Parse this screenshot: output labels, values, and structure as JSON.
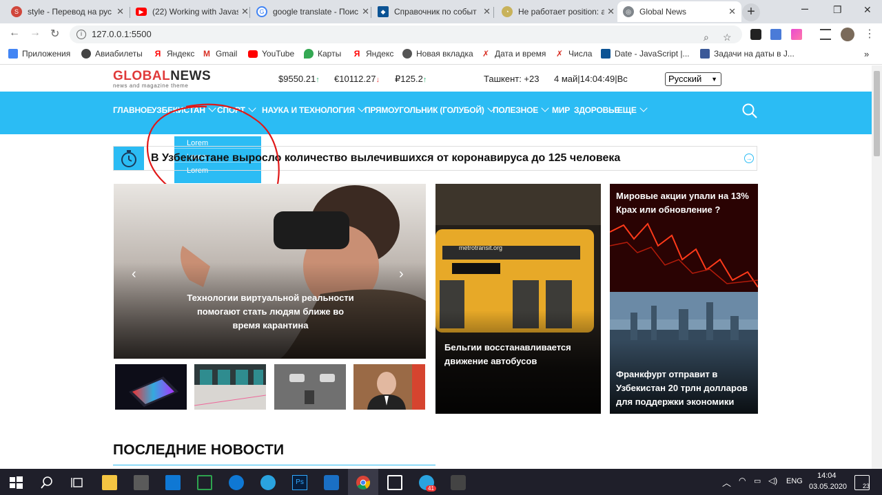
{
  "browser": {
    "tabs": [
      {
        "title": "style - Перевод на рус",
        "favicon_color": "#d0463b"
      },
      {
        "title": "(22) Working with Javas",
        "favicon_color": "#ff0000"
      },
      {
        "title": "google translate - Поис",
        "favicon_color": "#4285f4"
      },
      {
        "title": "Справочник по событ",
        "favicon_color": "#0b5394"
      },
      {
        "title": "Не работает position: a",
        "favicon_color": "#8a7a2a"
      },
      {
        "title": "Global News",
        "favicon_color": "#5f6368"
      }
    ],
    "address": "127.0.0.1:5500",
    "bookmarks": [
      {
        "label": "Приложения",
        "color": "#4285f4"
      },
      {
        "label": "Авиабилеты",
        "color": "#444444"
      },
      {
        "label": "Яндекс",
        "color": "#ff0000"
      },
      {
        "label": "Gmail",
        "color": "#d93025"
      },
      {
        "label": "YouTube",
        "color": "#ff0000"
      },
      {
        "label": "Карты",
        "color": "#34a853"
      },
      {
        "label": "Яндекс",
        "color": "#ff0000"
      },
      {
        "label": "Новая вкладка",
        "color": "#555555"
      },
      {
        "label": "Дата и время",
        "color": "#d93025"
      },
      {
        "label": "Числа",
        "color": "#d93025"
      },
      {
        "label": "Date - JavaScript |...",
        "color": "#0b5394"
      },
      {
        "label": "Задачи на даты в J...",
        "color": "#3b5998"
      }
    ]
  },
  "site": {
    "logo_main": "GLOBAL",
    "logo_second": "NEWS",
    "logo_tagline": "news and magazine theme",
    "currencies": [
      {
        "value": "$9550.21",
        "dir": "↑"
      },
      {
        "value": "€10112.27",
        "dir": "↓"
      },
      {
        "value": "₽125.2",
        "dir": "↑"
      }
    ],
    "weather": "Ташкент: +23",
    "datetime": "4 май|14:04:49|Вс",
    "language": "Русский",
    "nav": [
      "ГЛАВНОЕ",
      "УЗБЕКИСТАН",
      "СПОРТ",
      "НАУКА И ТЕХНОЛОГИЯ",
      "ПРЯМОУГОЛЬНИК (ГОЛУБОЙ)",
      "ПОЛЕЗНОЕ",
      "МИР",
      "ЗДОРОВЬЕ",
      "ЕЩЕ"
    ],
    "dropdown": [
      "Lorem",
      "Lorem",
      "Lorem"
    ],
    "ticker": "В Узбекистане выросло количество вылечившихся от коронавируса до 125 человека",
    "slider_caption": "Технологии виртуальной реальности помогают стать людям ближе во время карантина",
    "cards": {
      "bus": "Бельгии восстанавливается движение автобусов",
      "stocks": "Мировые акции упали на 13% Крах или обновление ?",
      "city": "Франкфурт отправит в Узбекистан 20 трлн долларов для поддержки экономики"
    },
    "bus_sign": "metrotransit.org",
    "latest_heading": "ПОСЛЕДНИЕ НОВОСТИ",
    "accent_color": "#2bbcf4"
  },
  "taskbar": {
    "lang": "ENG",
    "time": "14:04",
    "date": "03.05.2020",
    "notifications": "23",
    "telegram_badge": "41"
  }
}
